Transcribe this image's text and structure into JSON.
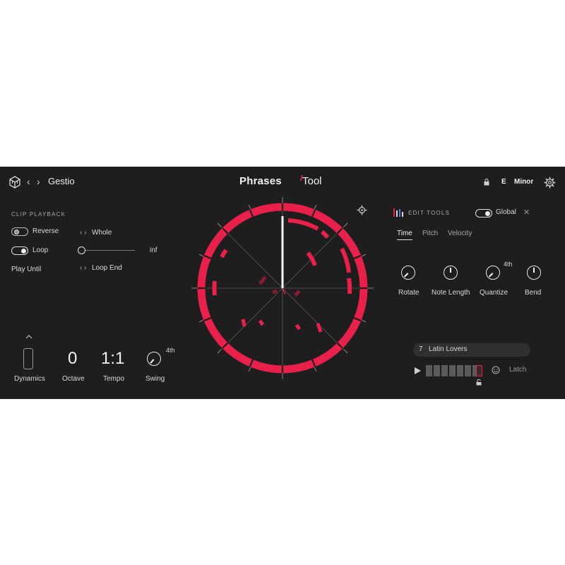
{
  "header": {
    "logo_icon": "cube-icon",
    "back_icon": "chevron-left-icon",
    "forward_icon": "chevron-right-icon",
    "preset_name": "Gestio",
    "title_main": "Phrases",
    "title_tool": "Tool",
    "lock_icon": "lock-icon",
    "key_note": "E",
    "key_scale": "Minor",
    "settings_icon": "gear-icon"
  },
  "clip_playback": {
    "section_label": "CLIP PLAYBACK",
    "reverse_label": "Reverse",
    "reverse_on": false,
    "loop_label": "Loop",
    "loop_on": true,
    "play_until_label": "Play Until",
    "whole_value": "Whole",
    "loop_end_value": "Loop End",
    "slider_max_label": "inf",
    "slider_value": 0
  },
  "controls": {
    "dynamics_label": "Dynamics",
    "octave_value": "0",
    "octave_label": "Octave",
    "tempo_value": "1:1",
    "tempo_label": "Tempo",
    "swing_label": "Swing",
    "swing_division": "4th"
  },
  "edit_tools": {
    "section_label": "EDIT TOOLS",
    "global_label": "Global",
    "global_on": true,
    "close_icon": "close-icon",
    "tabs": [
      {
        "label": "Time",
        "active": true
      },
      {
        "label": "Pitch",
        "active": false
      },
      {
        "label": "Velocity",
        "active": false
      }
    ],
    "knobs": [
      {
        "label": "Rotate"
      },
      {
        "label": "Note Length"
      },
      {
        "label": "Quantize",
        "division": "4th"
      },
      {
        "label": "Bend"
      }
    ]
  },
  "sequencer": {
    "preset_number": "7",
    "preset_name": "Latin Lovers",
    "play_icon": "play-icon",
    "latch_icon": "latch-icon",
    "latch_label": "Latch",
    "unlock_icon": "unlock-icon",
    "step_count": 8,
    "selected_step": 8
  },
  "colors": {
    "background": "#1e1e1f",
    "accent": "#e8204a",
    "accent_dim": "#8a1a30",
    "text": "#e6e6e6"
  }
}
